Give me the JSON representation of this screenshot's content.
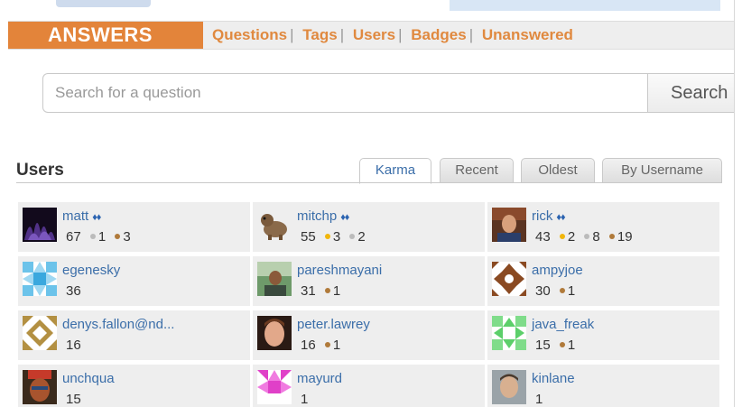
{
  "nav": {
    "brand": "ANSWERS",
    "links": [
      "Questions",
      "Tags",
      "Users",
      "Badges",
      "Unanswered"
    ],
    "separator": "|"
  },
  "search": {
    "placeholder": "Search for a question",
    "button": "Search"
  },
  "section": {
    "title": "Users"
  },
  "tabs": [
    "Karma",
    "Recent",
    "Oldest",
    "By Username"
  ],
  "users": [
    {
      "name": "matt",
      "diamonds": "♦♦",
      "karma": "67",
      "gold": null,
      "silver": "1",
      "bronze": "3",
      "avatar": "matt-avatar"
    },
    {
      "name": "mitchp",
      "diamonds": "♦♦",
      "karma": "55",
      "gold": "3",
      "silver": "2",
      "bronze": null,
      "avatar": "mitchp-avatar"
    },
    {
      "name": "rick",
      "diamonds": "♦♦",
      "karma": "43",
      "gold": "2",
      "silver": "8",
      "bronze": "19",
      "avatar": "rick-avatar"
    },
    {
      "name": "egenesky",
      "diamonds": "",
      "karma": "36",
      "gold": null,
      "silver": null,
      "bronze": null,
      "avatar": "egenesky-avatar"
    },
    {
      "name": "pareshmayani",
      "diamonds": "",
      "karma": "31",
      "gold": null,
      "silver": null,
      "bronze": "1",
      "avatar": "pareshmayani-avatar"
    },
    {
      "name": "ampyjoe",
      "diamonds": "",
      "karma": "30",
      "gold": null,
      "silver": null,
      "bronze": "1",
      "avatar": "ampyjoe-avatar"
    },
    {
      "name": "denys.fallon@nd...",
      "diamonds": "",
      "karma": "16",
      "gold": null,
      "silver": null,
      "bronze": null,
      "avatar": "denys-avatar"
    },
    {
      "name": "peter.lawrey",
      "diamonds": "",
      "karma": "16",
      "gold": null,
      "silver": null,
      "bronze": "1",
      "avatar": "peter-avatar"
    },
    {
      "name": "java_freak",
      "diamonds": "",
      "karma": "15",
      "gold": null,
      "silver": null,
      "bronze": "1",
      "avatar": "java-freak-avatar"
    },
    {
      "name": "unchqua",
      "diamonds": "",
      "karma": "15",
      "gold": null,
      "silver": null,
      "bronze": null,
      "avatar": "unchqua-avatar"
    },
    {
      "name": "mayurd",
      "diamonds": "",
      "karma": "1",
      "gold": null,
      "silver": null,
      "bronze": null,
      "avatar": "mayurd-avatar"
    },
    {
      "name": "kinlane",
      "diamonds": "",
      "karma": "1",
      "gold": null,
      "silver": null,
      "bronze": null,
      "avatar": "kinlane-avatar"
    }
  ],
  "colors": {
    "brand": "#e3843a",
    "link": "#3b6ea9",
    "gold": "#f1b60b",
    "silver": "#bbbbbb",
    "bronze": "#b07a3a"
  }
}
